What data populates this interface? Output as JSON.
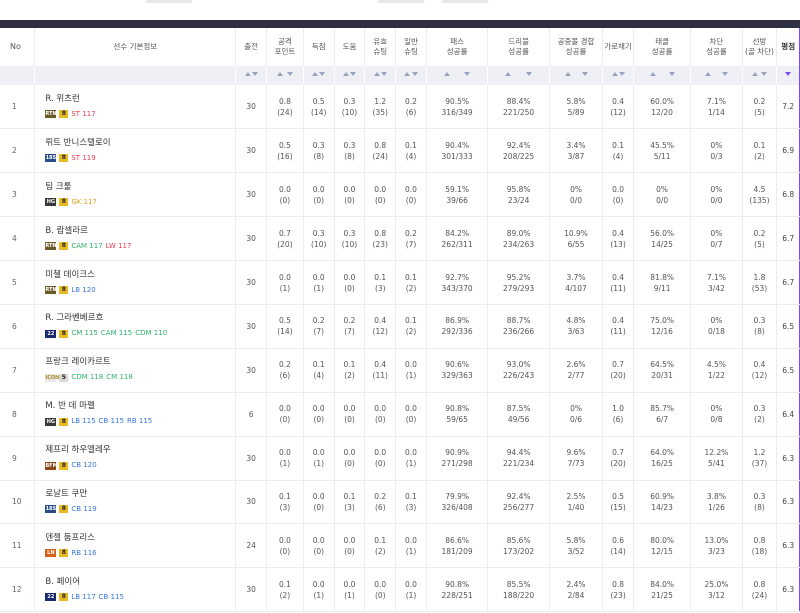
{
  "headers": {
    "no": "No",
    "player": "선수 기본정보",
    "apps": "출전",
    "attack_points": "공격\n포인트",
    "goals": "득점",
    "assists": "도움",
    "shots_on": "유효\n슈팅",
    "shots": "일반\n슈팅",
    "pass": "패스\n성공률",
    "dribble": "드리블\n성공률",
    "aerial": "공중볼 경합\n성공률",
    "intercept": "가로채기",
    "tackle": "태클\n성공률",
    "block": "차단\n성공률",
    "saves": "선방\n(골 차단)",
    "rating": "평점"
  },
  "colors": {
    "fw": "#e0405a",
    "mf": "#2fb36e",
    "df": "#3a78d8",
    "gk": "#e0a020",
    "accent": "#7b4cff",
    "topbar": "#2f2f45"
  },
  "rows": [
    {
      "no": "1",
      "name": "R. 위츠런",
      "season": "RTN",
      "season_color": "#6a5a2a",
      "grade": "8",
      "pos": [
        {
          "p": "ST",
          "v": "117",
          "c": "fw"
        }
      ],
      "apps": "30",
      "ap": [
        "0.8",
        "(24)"
      ],
      "g": [
        "0.5",
        "(14)"
      ],
      "a": [
        "0.3",
        "(10)"
      ],
      "son": [
        "1.2",
        "(35)"
      ],
      "sh": [
        "0.2",
        "(6)"
      ],
      "pass": [
        "90.5%",
        "316/349"
      ],
      "drb": [
        "88.4%",
        "221/250"
      ],
      "aer": [
        "5.8%",
        "5/89"
      ],
      "int": [
        "0.4",
        "(12)"
      ],
      "tkl": [
        "60.0%",
        "12/20"
      ],
      "blk": [
        "7.1%",
        "1/14"
      ],
      "sv": [
        "0.2",
        "(5)"
      ],
      "rt": "7.2"
    },
    {
      "no": "2",
      "name": "뤼트 반니스텔로이",
      "season": "18S",
      "season_color": "#2b4a8a",
      "grade": "8",
      "pos": [
        {
          "p": "ST",
          "v": "119",
          "c": "fw"
        }
      ],
      "apps": "30",
      "ap": [
        "0.5",
        "(16)"
      ],
      "g": [
        "0.3",
        "(8)"
      ],
      "a": [
        "0.3",
        "(8)"
      ],
      "son": [
        "0.8",
        "(24)"
      ],
      "sh": [
        "0.1",
        "(4)"
      ],
      "pass": [
        "90.4%",
        "301/333"
      ],
      "drb": [
        "92.4%",
        "208/225"
      ],
      "aer": [
        "3.4%",
        "3/87"
      ],
      "int": [
        "0.1",
        "(4)"
      ],
      "tkl": [
        "45.5%",
        "5/11"
      ],
      "blk": [
        "0%",
        "0/3"
      ],
      "sv": [
        "0.1",
        "(2)"
      ],
      "rt": "6.9"
    },
    {
      "no": "3",
      "name": "팀 크룰",
      "season": "HG",
      "season_color": "#3a3a3a",
      "grade": "8",
      "pos": [
        {
          "p": "GK",
          "v": "117",
          "c": "gk"
        }
      ],
      "apps": "30",
      "ap": [
        "0.0",
        "(0)"
      ],
      "g": [
        "0.0",
        "(0)"
      ],
      "a": [
        "0.0",
        "(0)"
      ],
      "son": [
        "0.0",
        "(0)"
      ],
      "sh": [
        "0.0",
        "(0)"
      ],
      "pass": [
        "59.1%",
        "39/66"
      ],
      "drb": [
        "95.8%",
        "23/24"
      ],
      "aer": [
        "0%",
        "0/0"
      ],
      "int": [
        "0.0",
        "(0)"
      ],
      "tkl": [
        "0%",
        "0/0"
      ],
      "blk": [
        "0%",
        "0/0"
      ],
      "sv": [
        "4.5",
        "(135)"
      ],
      "rt": "6.8"
    },
    {
      "no": "4",
      "name": "B. 랍셀라르",
      "season": "RTN",
      "season_color": "#6a5a2a",
      "grade": "8",
      "pos": [
        {
          "p": "CAM",
          "v": "117",
          "c": "mf"
        },
        {
          "p": "LW",
          "v": "117",
          "c": "fw"
        }
      ],
      "apps": "30",
      "ap": [
        "0.7",
        "(20)"
      ],
      "g": [
        "0.3",
        "(10)"
      ],
      "a": [
        "0.3",
        "(10)"
      ],
      "son": [
        "0.8",
        "(23)"
      ],
      "sh": [
        "0.2",
        "(7)"
      ],
      "pass": [
        "84.2%",
        "262/311"
      ],
      "drb": [
        "89.0%",
        "234/263"
      ],
      "aer": [
        "10.9%",
        "6/55"
      ],
      "int": [
        "0.4",
        "(13)"
      ],
      "tkl": [
        "56.0%",
        "14/25"
      ],
      "blk": [
        "0%",
        "0/7"
      ],
      "sv": [
        "0.2",
        "(5)"
      ],
      "rt": "6.7"
    },
    {
      "no": "5",
      "name": "미첼 데이크스",
      "season": "RTN",
      "season_color": "#6a5a2a",
      "grade": "8",
      "pos": [
        {
          "p": "LB",
          "v": "120",
          "c": "df"
        }
      ],
      "apps": "30",
      "ap": [
        "0.0",
        "(1)"
      ],
      "g": [
        "0.0",
        "(1)"
      ],
      "a": [
        "0.0",
        "(0)"
      ],
      "son": [
        "0.1",
        "(3)"
      ],
      "sh": [
        "0.1",
        "(2)"
      ],
      "pass": [
        "92.7%",
        "343/370"
      ],
      "drb": [
        "95.2%",
        "279/293"
      ],
      "aer": [
        "3.7%",
        "4/107"
      ],
      "int": [
        "0.4",
        "(11)"
      ],
      "tkl": [
        "81.8%",
        "9/11"
      ],
      "blk": [
        "7.1%",
        "3/42"
      ],
      "sv": [
        "1.8",
        "(53)"
      ],
      "rt": "6.7"
    },
    {
      "no": "6",
      "name": "R. 그라벤베르흐",
      "season": "22",
      "season_color": "#1b2a6b",
      "grade": "8",
      "pos": [
        {
          "p": "CM",
          "v": "115",
          "c": "mf"
        },
        {
          "p": "CAM",
          "v": "115",
          "c": "mf"
        },
        {
          "p": "CDM",
          "v": "110",
          "c": "mf"
        }
      ],
      "apps": "30",
      "ap": [
        "0.5",
        "(14)"
      ],
      "g": [
        "0.2",
        "(7)"
      ],
      "a": [
        "0.2",
        "(7)"
      ],
      "son": [
        "0.4",
        "(12)"
      ],
      "sh": [
        "0.1",
        "(2)"
      ],
      "pass": [
        "86.9%",
        "292/336"
      ],
      "drb": [
        "88.7%",
        "236/266"
      ],
      "aer": [
        "4.8%",
        "3/63"
      ],
      "int": [
        "0.4",
        "(11)"
      ],
      "tkl": [
        "75.0%",
        "12/16"
      ],
      "blk": [
        "0%",
        "0/18"
      ],
      "sv": [
        "0.3",
        "(8)"
      ],
      "rt": "6.5"
    },
    {
      "no": "7",
      "name": "프랑크 레이카르트",
      "season": "ICON",
      "season_color": "#e6e6e6",
      "grade": "5",
      "pos": [
        {
          "p": "CDM",
          "v": "118",
          "c": "mf"
        },
        {
          "p": "CM",
          "v": "118",
          "c": "mf"
        }
      ],
      "apps": "30",
      "ap": [
        "0.2",
        "(6)"
      ],
      "g": [
        "0.1",
        "(4)"
      ],
      "a": [
        "0.1",
        "(2)"
      ],
      "son": [
        "0.4",
        "(11)"
      ],
      "sh": [
        "0.0",
        "(1)"
      ],
      "pass": [
        "90.6%",
        "329/363"
      ],
      "drb": [
        "93.0%",
        "226/243"
      ],
      "aer": [
        "2.6%",
        "2/77"
      ],
      "int": [
        "0.7",
        "(20)"
      ],
      "tkl": [
        "64.5%",
        "20/31"
      ],
      "blk": [
        "4.5%",
        "1/22"
      ],
      "sv": [
        "0.4",
        "(12)"
      ],
      "rt": "6.5"
    },
    {
      "no": "8",
      "name": "M. 반 데 마펠",
      "season": "HG",
      "season_color": "#3a3a3a",
      "grade": "8",
      "pos": [
        {
          "p": "LB",
          "v": "115",
          "c": "df"
        },
        {
          "p": "CB",
          "v": "115",
          "c": "df"
        },
        {
          "p": "RB",
          "v": "115",
          "c": "df"
        }
      ],
      "apps": "6",
      "ap": [
        "0.0",
        "(0)"
      ],
      "g": [
        "0.0",
        "(0)"
      ],
      "a": [
        "0.0",
        "(0)"
      ],
      "son": [
        "0.0",
        "(0)"
      ],
      "sh": [
        "0.0",
        "(0)"
      ],
      "pass": [
        "90.8%",
        "59/65"
      ],
      "drb": [
        "87.5%",
        "49/56"
      ],
      "aer": [
        "0%",
        "0/6"
      ],
      "int": [
        "1.0",
        "(6)"
      ],
      "tkl": [
        "85.7%",
        "6/7"
      ],
      "blk": [
        "0%",
        "0/8"
      ],
      "sv": [
        "0.3",
        "(2)"
      ],
      "rt": "6.4"
    },
    {
      "no": "9",
      "name": "제프리 하우엘레우",
      "season": "BFM",
      "season_color": "#8a4a1a",
      "grade": "8",
      "pos": [
        {
          "p": "CB",
          "v": "120",
          "c": "df"
        }
      ],
      "apps": "30",
      "ap": [
        "0.0",
        "(1)"
      ],
      "g": [
        "0.0",
        "(1)"
      ],
      "a": [
        "0.0",
        "(0)"
      ],
      "son": [
        "0.0",
        "(0)"
      ],
      "sh": [
        "0.0",
        "(1)"
      ],
      "pass": [
        "90.9%",
        "271/298"
      ],
      "drb": [
        "94.4%",
        "221/234"
      ],
      "aer": [
        "9.6%",
        "7/73"
      ],
      "int": [
        "0.7",
        "(20)"
      ],
      "tkl": [
        "64.0%",
        "16/25"
      ],
      "blk": [
        "12.2%",
        "5/41"
      ],
      "sv": [
        "1.2",
        "(37)"
      ],
      "rt": "6.3"
    },
    {
      "no": "10",
      "name": "로날트 쿠만",
      "season": "18S",
      "season_color": "#2b4a8a",
      "grade": "8",
      "pos": [
        {
          "p": "CB",
          "v": "119",
          "c": "df"
        }
      ],
      "apps": "30",
      "ap": [
        "0.1",
        "(3)"
      ],
      "g": [
        "0.0",
        "(0)"
      ],
      "a": [
        "0.1",
        "(3)"
      ],
      "son": [
        "0.2",
        "(6)"
      ],
      "sh": [
        "0.1",
        "(3)"
      ],
      "pass": [
        "79.9%",
        "326/408"
      ],
      "drb": [
        "92.4%",
        "256/277"
      ],
      "aer": [
        "2.5%",
        "1/40"
      ],
      "int": [
        "0.5",
        "(15)"
      ],
      "tkl": [
        "60.9%",
        "14/23"
      ],
      "blk": [
        "3.8%",
        "1/26"
      ],
      "sv": [
        "0.3",
        "(8)"
      ],
      "rt": "6.3"
    },
    {
      "no": "11",
      "name": "덴젤 둠프리스",
      "season": "LN",
      "season_color": "#d9621a",
      "grade": "8",
      "pos": [
        {
          "p": "RB",
          "v": "116",
          "c": "df"
        }
      ],
      "apps": "24",
      "ap": [
        "0.0",
        "(0)"
      ],
      "g": [
        "0.0",
        "(0)"
      ],
      "a": [
        "0.0",
        "(0)"
      ],
      "son": [
        "0.1",
        "(2)"
      ],
      "sh": [
        "0.0",
        "(1)"
      ],
      "pass": [
        "86.6%",
        "181/209"
      ],
      "drb": [
        "85.6%",
        "173/202"
      ],
      "aer": [
        "5.8%",
        "3/52"
      ],
      "int": [
        "0.6",
        "(14)"
      ],
      "tkl": [
        "80.0%",
        "12/15"
      ],
      "blk": [
        "13.0%",
        "3/23"
      ],
      "sv": [
        "0.8",
        "(18)"
      ],
      "rt": "6.3"
    },
    {
      "no": "12",
      "name": "B. 페이어",
      "season": "22",
      "season_color": "#1b2a6b",
      "grade": "8",
      "pos": [
        {
          "p": "LB",
          "v": "117",
          "c": "df"
        },
        {
          "p": "CB",
          "v": "115",
          "c": "df"
        }
      ],
      "apps": "30",
      "ap": [
        "0.1",
        "(2)"
      ],
      "g": [
        "0.0",
        "(1)"
      ],
      "a": [
        "0.0",
        "(1)"
      ],
      "son": [
        "0.0",
        "(0)"
      ],
      "sh": [
        "0.0",
        "(1)"
      ],
      "pass": [
        "90.8%",
        "228/251"
      ],
      "drb": [
        "85.5%",
        "188/220"
      ],
      "aer": [
        "2.4%",
        "2/84"
      ],
      "int": [
        "0.8",
        "(23)"
      ],
      "tkl": [
        "84.0%",
        "21/25"
      ],
      "blk": [
        "25.0%",
        "3/12"
      ],
      "sv": [
        "0.8",
        "(24)"
      ],
      "rt": "6.3"
    }
  ]
}
